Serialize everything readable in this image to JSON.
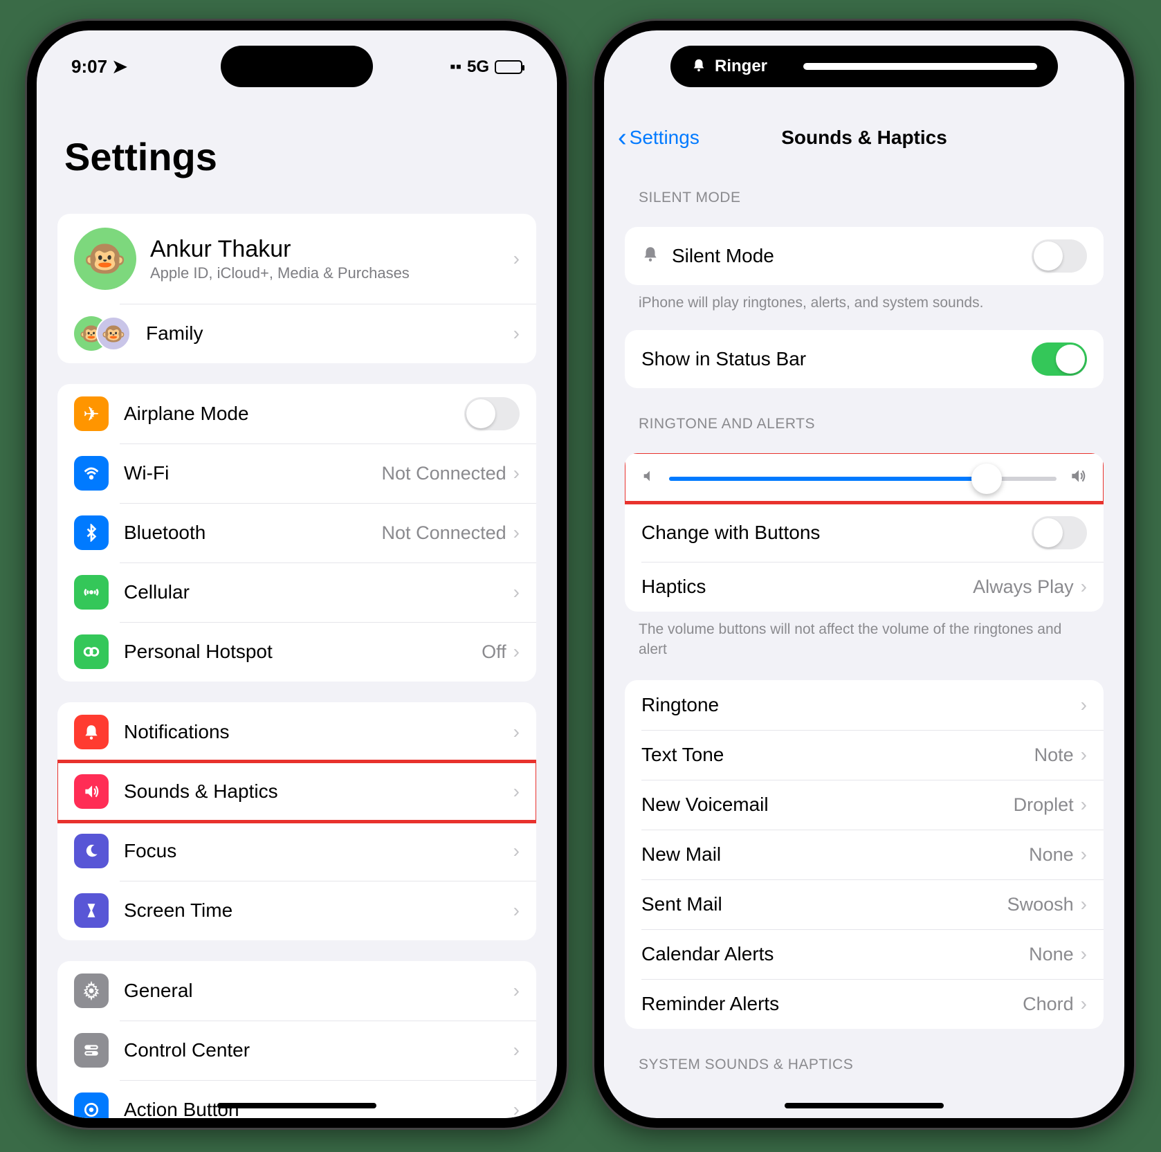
{
  "phone1": {
    "status_time": "9:07",
    "status_net": "5G",
    "title": "Settings",
    "profile": {
      "name": "Ankur Thakur",
      "subtitle": "Apple ID, iCloud+, Media & Purchases",
      "family": "Family"
    },
    "g1": {
      "airplane": "Airplane Mode",
      "wifi": "Wi-Fi",
      "wifi_val": "Not Connected",
      "bt": "Bluetooth",
      "bt_val": "Not Connected",
      "cellular": "Cellular",
      "hotspot": "Personal Hotspot",
      "hotspot_val": "Off"
    },
    "g2": {
      "notifications": "Notifications",
      "sounds": "Sounds & Haptics",
      "focus": "Focus",
      "screentime": "Screen Time"
    },
    "g3": {
      "general": "General",
      "control": "Control Center",
      "action": "Action Button"
    }
  },
  "phone2": {
    "di_label": "Ringer",
    "back": "Settings",
    "title": "Sounds & Haptics",
    "silent_header": "SILENT MODE",
    "silent": "Silent Mode",
    "silent_footer": "iPhone will play ringtones, alerts, and system sounds.",
    "statusbar_row": "Show in Status Bar",
    "ring_header": "RINGTONE AND ALERTS",
    "change_buttons": "Change with Buttons",
    "haptics": "Haptics",
    "haptics_val": "Always Play",
    "ring_footer": "The volume buttons will not affect the volume of the ringtones and alert",
    "sounds": {
      "ringtone": "Ringtone",
      "ringtone_val": "",
      "texttone": "Text Tone",
      "texttone_val": "Note",
      "voicemail": "New Voicemail",
      "voicemail_val": "Droplet",
      "newmail": "New Mail",
      "newmail_val": "None",
      "sentmail": "Sent Mail",
      "sentmail_val": "Swoosh",
      "calendar": "Calendar Alerts",
      "calendar_val": "None",
      "reminder": "Reminder Alerts",
      "reminder_val": "Chord"
    },
    "system_header": "SYSTEM SOUNDS & HAPTICS",
    "slider_percent": 82
  }
}
